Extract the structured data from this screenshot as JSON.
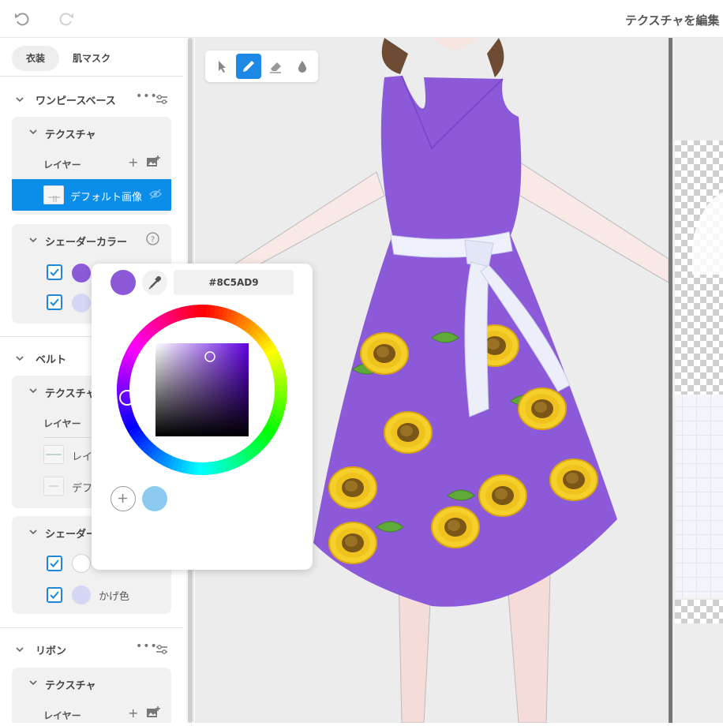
{
  "header": {
    "title": "テクスチャを編集"
  },
  "sidebar": {
    "tabs": [
      {
        "label": "衣装",
        "active": true
      },
      {
        "label": "肌マスク",
        "active": false
      }
    ],
    "sections": {
      "onepiece": {
        "title": "ワンピースベース",
        "texture_label": "テクスチャ",
        "layer_label": "レイヤー",
        "selected_layer": "デフォルト画像",
        "shader_label": "シェーダーカラー"
      },
      "belt": {
        "title": "ベルト",
        "texture_label": "テクスチャ",
        "layer_label": "レイヤー",
        "layer_1": "レイヤー",
        "layer_2": "デフォルト画像",
        "shader_label": "シェーダーカラー",
        "shadow_label": "かげ色"
      },
      "ribbon": {
        "title": "リボン",
        "texture_label": "テクスチャ",
        "layer_label": "レイヤー"
      }
    }
  },
  "picker": {
    "hex_value": "#8C5AD9",
    "current_color": "#8C5AD9",
    "saved_swatch": "#8ccbef"
  },
  "colors": {
    "accent": "#0a8eea",
    "purple": "#8c5ad9",
    "lavender": "#d4d8f5"
  }
}
